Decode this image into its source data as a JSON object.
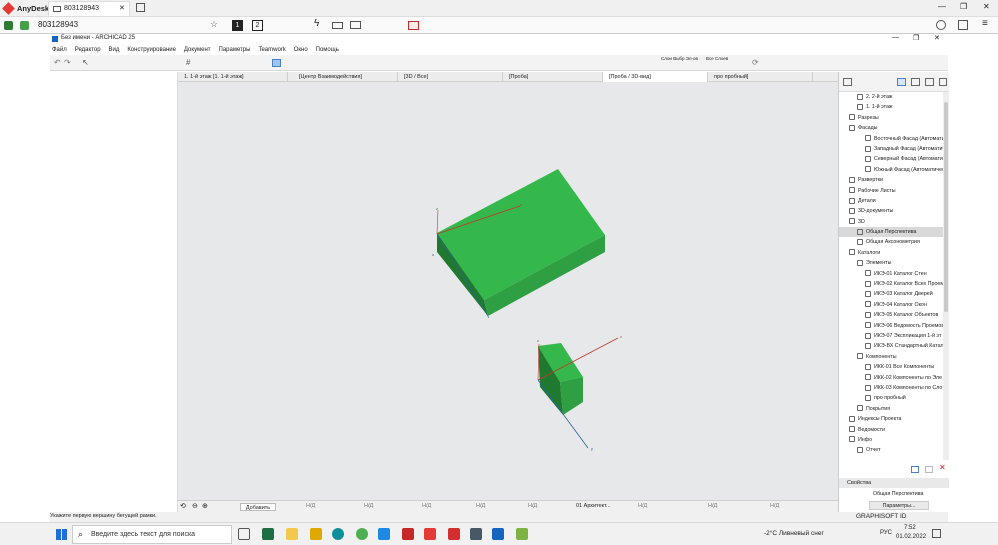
{
  "anydesk": {
    "app_name": "AnyDesk",
    "tab_label": "803128943",
    "address_value": "803128943",
    "page_indicator_1": "1",
    "page_indicator_2": "2"
  },
  "archicad": {
    "title": "Без имени - ARCHICAD 25",
    "menu": [
      "Файл",
      "Редактор",
      "Вид",
      "Конструирование",
      "Документ",
      "Параметры",
      "Teamwork",
      "Окно",
      "Помощь"
    ],
    "toolbar_labels": {
      "layers": "Слои Выбр.Эл-ов",
      "all_layers": "Все Слоев"
    },
    "tabs": [
      "1. 1-й этаж [1. 1-й этаж]",
      "[Центр Взаимодействия]",
      "[3D / Все]",
      "[Проба]",
      "[Проба / 3D-вид]",
      "про пробный]"
    ],
    "status_text": "Укажите первую вершину бегущей рамки.",
    "bottom_bar": {
      "add_label": "Добавить",
      "nd": "Н/Д",
      "layer": "01 Архитект..."
    },
    "axis_labels": {
      "z": "z",
      "x": "x",
      "y": "y",
      "o": "o"
    }
  },
  "navigator": {
    "tree": [
      {
        "label": "2. 2-й этаж",
        "indent": 1
      },
      {
        "label": "1. 1-й этаж",
        "indent": 1
      },
      {
        "label": "Разрезы",
        "indent": 0
      },
      {
        "label": "Фасады",
        "indent": 0
      },
      {
        "label": "Восточный Фасад (Автомати",
        "indent": 2
      },
      {
        "label": "Западный Фасад (Автоматиче",
        "indent": 2
      },
      {
        "label": "Северный Фасад (Автоматиче",
        "indent": 2
      },
      {
        "label": "Южный Фасад (Автоматическ",
        "indent": 2
      },
      {
        "label": "Развертки",
        "indent": 0
      },
      {
        "label": "Рабочие Листы",
        "indent": 0
      },
      {
        "label": "Детали",
        "indent": 0
      },
      {
        "label": "3D-документы",
        "indent": 0
      },
      {
        "label": "3D",
        "indent": 0
      },
      {
        "label": "Общая Перспектива",
        "indent": 1,
        "selected": true
      },
      {
        "label": "Общая Аксонометрия",
        "indent": 1
      },
      {
        "label": "Каталоги",
        "indent": 0
      },
      {
        "label": "Элементы",
        "indent": 1
      },
      {
        "label": "ИКЭ-01 Каталог Стен",
        "indent": 2
      },
      {
        "label": "ИКЭ-02 Каталог Всех Проем",
        "indent": 2
      },
      {
        "label": "ИКЭ-03 Каталог Дверей",
        "indent": 2
      },
      {
        "label": "ИКЭ-04 Каталог Окон",
        "indent": 2
      },
      {
        "label": "ИКЭ-05 Каталог Объектов",
        "indent": 2
      },
      {
        "label": "ИКЭ-06 Ведомость Проемов",
        "indent": 2
      },
      {
        "label": "ИКЭ-07 Экспликация 1-й эт",
        "indent": 2
      },
      {
        "label": "ИКЭ-ВХ Стандартный Катало",
        "indent": 2
      },
      {
        "label": "Компоненты",
        "indent": 1
      },
      {
        "label": "ИКК-01 Все Компоненты",
        "indent": 2
      },
      {
        "label": "ИКК-02 Компоненты по Эле",
        "indent": 2
      },
      {
        "label": "ИКК-03 Компоненты по Сло",
        "indent": 2
      },
      {
        "label": "про пробный",
        "indent": 2
      },
      {
        "label": "Покрытия",
        "indent": 1
      },
      {
        "label": "Индексы Проекта",
        "indent": 0
      },
      {
        "label": "Ведомости",
        "indent": 0
      },
      {
        "label": "Инфо",
        "indent": 0
      },
      {
        "label": "Отчет",
        "indent": 1
      }
    ],
    "properties_header": "Свойства",
    "properties_value": "Общая Перспектива",
    "params_button": "Параметры...",
    "brand": "GRAPHISOFT ID"
  },
  "taskbar": {
    "search_placeholder": "Введите здесь текст для поиска",
    "weather": "-2°C  Ливневый снег",
    "lang": "РУС",
    "time": "7:52",
    "date": "01.02.2022"
  },
  "colors": {
    "green": "#2ea043",
    "green_dark": "#1f7a30",
    "green_top": "#35b84b",
    "axis_red": "#c0392b",
    "axis_blue": "#2b5fa8"
  }
}
